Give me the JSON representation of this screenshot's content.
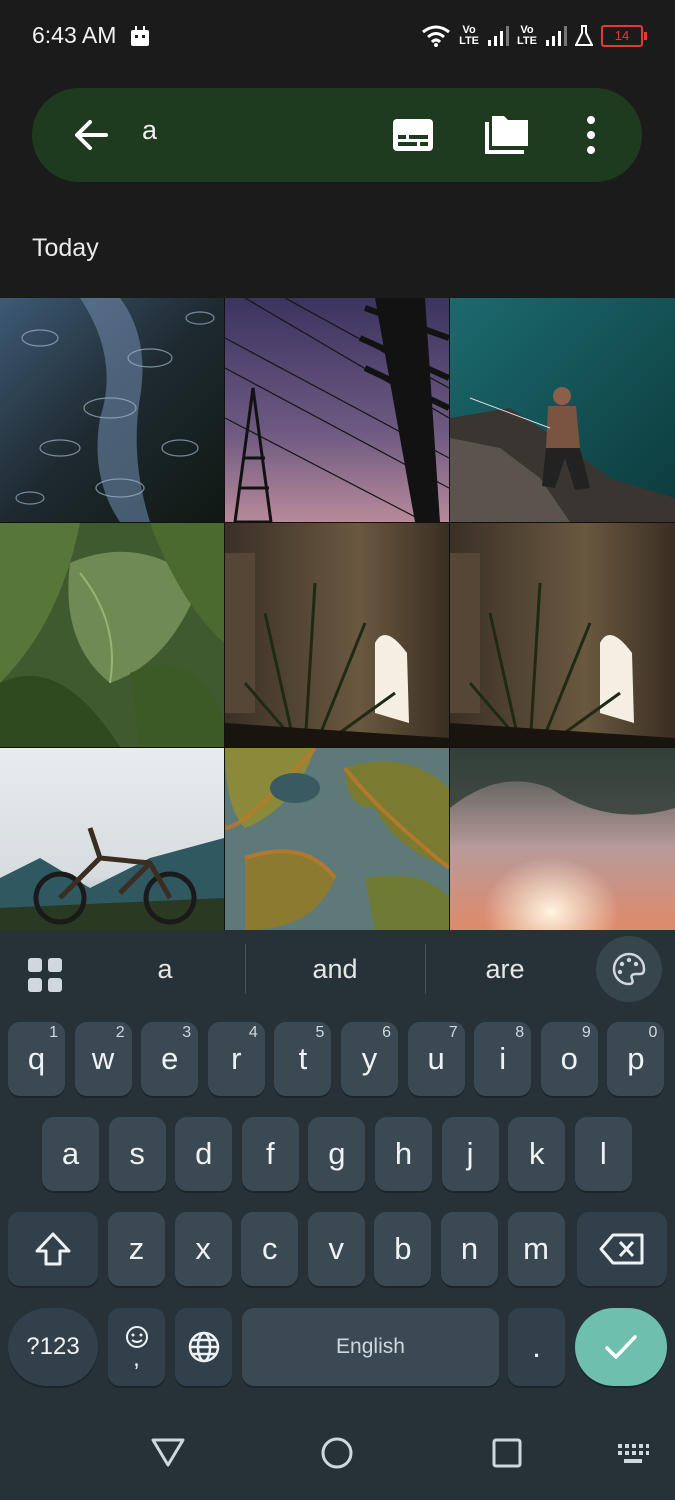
{
  "status": {
    "time": "6:43 AM",
    "lte1": "Vo\nLTE",
    "lte2": "Vo\nLTE",
    "battery": "14"
  },
  "search": {
    "query": "a"
  },
  "section": {
    "title": "Today"
  },
  "suggestions": [
    "a",
    "and",
    "are"
  ],
  "keys": {
    "row1": [
      {
        "k": "q",
        "h": "1"
      },
      {
        "k": "w",
        "h": "2"
      },
      {
        "k": "e",
        "h": "3"
      },
      {
        "k": "r",
        "h": "4"
      },
      {
        "k": "t",
        "h": "5"
      },
      {
        "k": "y",
        "h": "6"
      },
      {
        "k": "u",
        "h": "7"
      },
      {
        "k": "i",
        "h": "8"
      },
      {
        "k": "o",
        "h": "9"
      },
      {
        "k": "p",
        "h": "0"
      }
    ],
    "row2": [
      "a",
      "s",
      "d",
      "f",
      "g",
      "h",
      "j",
      "k",
      "l"
    ],
    "row3": [
      "z",
      "x",
      "c",
      "v",
      "b",
      "n",
      "m"
    ],
    "symbols": "?123",
    "comma": ",",
    "space": "English",
    "period": "."
  },
  "colors": {
    "searchbar": "#1e3a1f",
    "keyboard": "#263238",
    "key": "#3b4a52",
    "enter": "#6fbfae"
  },
  "icons": [
    "back-arrow-icon",
    "subtitles-icon",
    "folder-icon",
    "more-vert-icon",
    "apps-grid-icon",
    "palette-icon",
    "shift-icon",
    "backspace-icon",
    "emoji-icon",
    "globe-icon",
    "check-icon",
    "nav-back-icon",
    "nav-home-icon",
    "nav-recents-icon",
    "keyboard-icon"
  ]
}
